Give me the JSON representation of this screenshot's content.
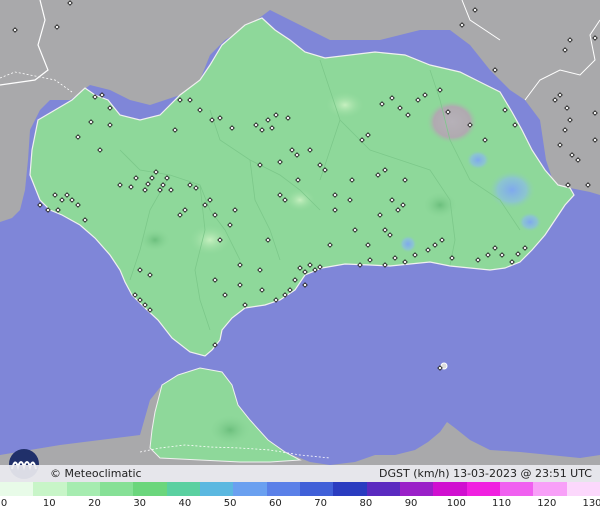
{
  "footer": {
    "brand": "© Meteoclimatic",
    "title": "DGST (km/h)   13-03-2023 @ 23:51 UTC"
  },
  "legend": {
    "ticks": [
      "0",
      "10",
      "20",
      "30",
      "40",
      "50",
      "60",
      "70",
      "80",
      "90",
      "100",
      "110",
      "120",
      "130"
    ],
    "colors": [
      "#e8fbe8",
      "#c8f5c8",
      "#a6ecb0",
      "#86e096",
      "#6bd67c",
      "#5ad0a0",
      "#5bb8e0",
      "#6aa0f0",
      "#5a80e8",
      "#4060d8",
      "#2a3cc0",
      "#5a2ac0",
      "#9a20c8",
      "#d010d0",
      "#f020e0",
      "#f060f0",
      "#f8a0f8",
      "#fcd8fc"
    ]
  },
  "colors": {
    "sea": "#7f86d8",
    "land_region": "#8ed89a",
    "land_outside": "#a9a9ab"
  },
  "map": {
    "stations": [
      [
        15,
        30
      ],
      [
        57,
        27
      ],
      [
        70,
        3
      ],
      [
        78,
        137
      ],
      [
        91,
        122
      ],
      [
        95,
        97
      ],
      [
        102,
        95
      ],
      [
        120,
        185
      ],
      [
        136,
        178
      ],
      [
        145,
        190
      ],
      [
        148,
        184
      ],
      [
        152,
        178
      ],
      [
        156,
        172
      ],
      [
        160,
        190
      ],
      [
        163,
        185
      ],
      [
        167,
        178
      ],
      [
        171,
        190
      ],
      [
        131,
        187
      ],
      [
        55,
        195
      ],
      [
        62,
        200
      ],
      [
        67,
        195
      ],
      [
        72,
        200
      ],
      [
        58,
        210
      ],
      [
        85,
        220
      ],
      [
        78,
        205
      ],
      [
        48,
        210
      ],
      [
        40,
        205
      ],
      [
        190,
        185
      ],
      [
        196,
        188
      ],
      [
        185,
        210
      ],
      [
        180,
        215
      ],
      [
        205,
        205
      ],
      [
        210,
        200
      ],
      [
        215,
        215
      ],
      [
        190,
        100
      ],
      [
        200,
        110
      ],
      [
        212,
        120
      ],
      [
        220,
        118
      ],
      [
        232,
        128
      ],
      [
        256,
        125
      ],
      [
        262,
        130
      ],
      [
        268,
        120
      ],
      [
        272,
        128
      ],
      [
        276,
        115
      ],
      [
        288,
        118
      ],
      [
        292,
        150
      ],
      [
        297,
        155
      ],
      [
        310,
        150
      ],
      [
        320,
        165
      ],
      [
        325,
        170
      ],
      [
        335,
        195
      ],
      [
        352,
        180
      ],
      [
        362,
        140
      ],
      [
        368,
        135
      ],
      [
        378,
        175
      ],
      [
        385,
        170
      ],
      [
        392,
        200
      ],
      [
        398,
        210
      ],
      [
        403,
        205
      ],
      [
        405,
        180
      ],
      [
        380,
        215
      ],
      [
        385,
        230
      ],
      [
        390,
        235
      ],
      [
        350,
        200
      ],
      [
        360,
        265
      ],
      [
        370,
        260
      ],
      [
        385,
        265
      ],
      [
        395,
        258
      ],
      [
        405,
        262
      ],
      [
        415,
        255
      ],
      [
        428,
        250
      ],
      [
        435,
        245
      ],
      [
        442,
        240
      ],
      [
        452,
        258
      ],
      [
        478,
        260
      ],
      [
        488,
        255
      ],
      [
        495,
        248
      ],
      [
        502,
        255
      ],
      [
        512,
        262
      ],
      [
        518,
        254
      ],
      [
        525,
        248
      ],
      [
        382,
        104
      ],
      [
        392,
        98
      ],
      [
        400,
        108
      ],
      [
        408,
        115
      ],
      [
        418,
        100
      ],
      [
        425,
        95
      ],
      [
        440,
        90
      ],
      [
        448,
        112
      ],
      [
        470,
        125
      ],
      [
        485,
        140
      ],
      [
        495,
        70
      ],
      [
        505,
        110
      ],
      [
        515,
        125
      ],
      [
        300,
        268
      ],
      [
        305,
        272
      ],
      [
        310,
        265
      ],
      [
        315,
        270
      ],
      [
        320,
        267
      ],
      [
        295,
        280
      ],
      [
        305,
        285
      ],
      [
        290,
        290
      ],
      [
        285,
        295
      ],
      [
        276,
        300
      ],
      [
        262,
        290
      ],
      [
        240,
        285
      ],
      [
        245,
        305
      ],
      [
        225,
        295
      ],
      [
        215,
        345
      ],
      [
        215,
        280
      ],
      [
        240,
        265
      ],
      [
        260,
        270
      ],
      [
        268,
        240
      ],
      [
        280,
        195
      ],
      [
        285,
        200
      ],
      [
        298,
        180
      ],
      [
        140,
        300
      ],
      [
        145,
        305
      ],
      [
        150,
        310
      ],
      [
        135,
        295
      ],
      [
        140,
        270
      ],
      [
        150,
        275
      ],
      [
        100,
        150
      ],
      [
        110,
        125
      ],
      [
        110,
        108
      ],
      [
        555,
        100
      ],
      [
        560,
        95
      ],
      [
        567,
        108
      ],
      [
        570,
        120
      ],
      [
        578,
        160
      ],
      [
        572,
        155
      ],
      [
        565,
        130
      ],
      [
        560,
        145
      ],
      [
        568,
        185
      ],
      [
        570,
        40
      ],
      [
        565,
        50
      ],
      [
        595,
        38
      ],
      [
        595,
        113
      ],
      [
        595,
        140
      ],
      [
        588,
        185
      ],
      [
        475,
        10
      ],
      [
        462,
        25
      ],
      [
        440,
        368
      ],
      [
        180,
        100
      ],
      [
        175,
        130
      ],
      [
        235,
        210
      ],
      [
        230,
        225
      ],
      [
        220,
        240
      ],
      [
        260,
        165
      ],
      [
        280,
        162
      ],
      [
        330,
        245
      ],
      [
        335,
        210
      ],
      [
        355,
        230
      ],
      [
        368,
        245
      ]
    ]
  }
}
